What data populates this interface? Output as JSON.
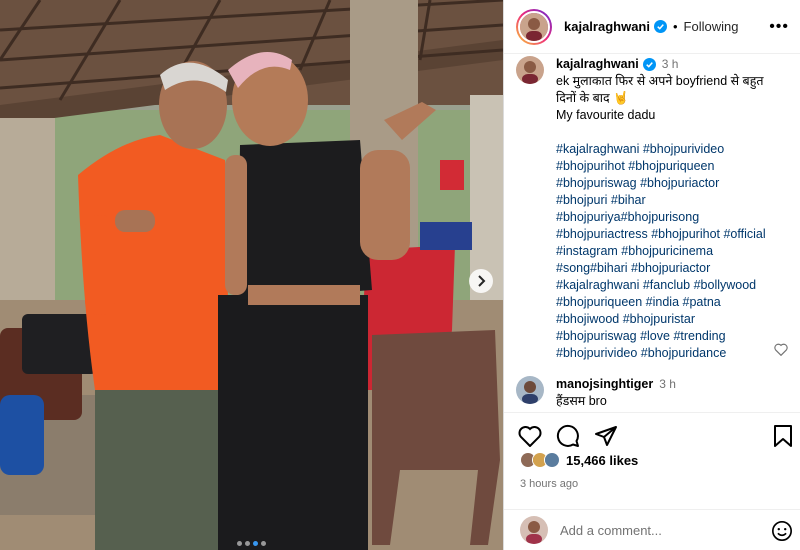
{
  "post": {
    "author": "kajalraghwani",
    "follow_label": "Following",
    "bullet": "•",
    "more_icon": "more-horizontal-icon",
    "caption_time": "3 h",
    "caption_lines": [
      "ek मुलाकात फिर से अपने boyfriend से बहुत",
      "दिनों के बाद 🤘",
      "My favourite dadu"
    ],
    "hashtags": [
      "#kajalraghwani #bhojpurivideo",
      "#bhojpurihot #bhojpuriqueen",
      "#bhojpuriswag #bhojpuriactor",
      "#bhojpuri #bihar",
      "#bhojpuriya#bhojpurisong",
      "#bhojpuriactress #bhojpurihot #official",
      "#instagram #bhojpuricinema",
      "#song#bihari #bhojpuriactor",
      "#kajalraghwani #fanclub #bollywood",
      "#bhojpuriqueen #india #patna",
      "#bhojiwood #bhojpuristar",
      "#bhojpuriswag #love #trending",
      "#bhojpurivideo #bhojpuridance"
    ]
  },
  "comment": {
    "user": "manojsinghtiger",
    "time": "3 h",
    "text": "हैंडसम bro"
  },
  "actions": {
    "like_icon": "heart-icon",
    "comment_icon": "comment-icon",
    "share_icon": "share-icon",
    "save_icon": "bookmark-icon"
  },
  "likes": {
    "count_text": "15,466 likes"
  },
  "time_ago": "3 hours ago",
  "composer": {
    "placeholder": "Add a comment...",
    "emoji_icon": "emoji-icon"
  },
  "carousel": {
    "slides": 4,
    "active": 2,
    "next_icon": "chevron-right-icon"
  },
  "colors": {
    "link": "#00376b",
    "verified": "#0095f6",
    "muted": "#737373"
  }
}
